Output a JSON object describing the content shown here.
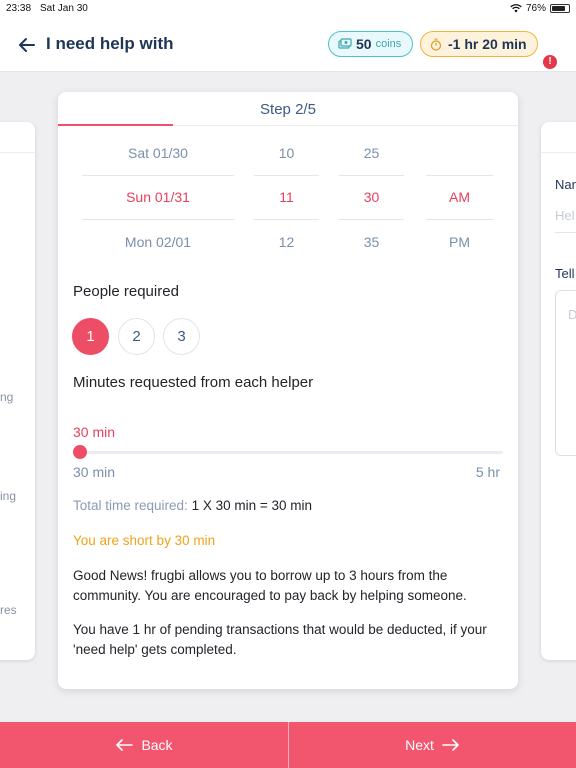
{
  "status": {
    "time": "23:38",
    "date": "Sat Jan 30",
    "battery": "76%"
  },
  "header": {
    "title": "I need help with",
    "coins_value": "50",
    "coins_unit": "coins",
    "time_balance": "-1 hr 20 min",
    "alert": "!"
  },
  "left_card": {
    "fragments": [
      "ng",
      "ing",
      "res"
    ]
  },
  "right_card": {
    "name_label": "Nar",
    "name_hint": "Hel",
    "tell_label": "Tell",
    "textbox_hint": "D"
  },
  "step": {
    "title": "Step 2/5"
  },
  "picker": {
    "dates": [
      "Sat 01/30",
      "Sun 01/31",
      "Mon 02/01"
    ],
    "hours": [
      "10",
      "11",
      "12"
    ],
    "minutes": [
      "25",
      "30",
      "35"
    ],
    "ampm": [
      "",
      "AM",
      "PM"
    ],
    "selected_index": 1
  },
  "people": {
    "label": "People required",
    "options": [
      "1",
      "2",
      "3"
    ],
    "selected": "1"
  },
  "minutes": {
    "label": "Minutes requested from each helper",
    "value_label": "30 min",
    "min_label": "30 min",
    "max_label": "5 hr",
    "fraction": 0
  },
  "total": {
    "label": "Total time required:",
    "value": "1 X 30 min = 30 min"
  },
  "short": {
    "text": "You are short by 30 min"
  },
  "info": {
    "good_news": "Good News! frugbi allows you to borrow up to 3 hours from the community. You are encouraged to pay back by helping someone.",
    "pending": "You have 1 hr  of pending transactions that would be deducted, if your 'need help' gets completed."
  },
  "footer": {
    "back_label": "Back",
    "next_label": "Next"
  },
  "colors": {
    "accent": "#ee4d66",
    "navy": "#1f3558",
    "warning": "#f0a21a",
    "teal": "#4cc3cf"
  }
}
